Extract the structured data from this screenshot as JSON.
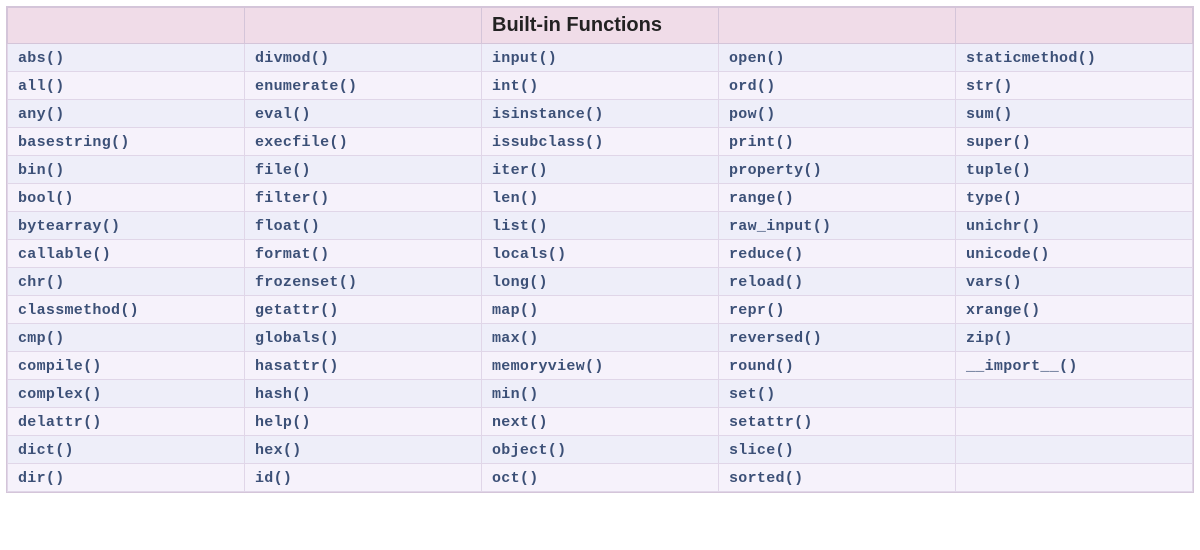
{
  "header": {
    "title": "Built-in Functions"
  },
  "columns": [
    [
      "abs()",
      "all()",
      "any()",
      "basestring()",
      "bin()",
      "bool()",
      "bytearray()",
      "callable()",
      "chr()",
      "classmethod()",
      "cmp()",
      "compile()",
      "complex()",
      "delattr()",
      "dict()",
      "dir()"
    ],
    [
      "divmod()",
      "enumerate()",
      "eval()",
      "execfile()",
      "file()",
      "filter()",
      "float()",
      "format()",
      "frozenset()",
      "getattr()",
      "globals()",
      "hasattr()",
      "hash()",
      "help()",
      "hex()",
      "id()"
    ],
    [
      "input()",
      "int()",
      "isinstance()",
      "issubclass()",
      "iter()",
      "len()",
      "list()",
      "locals()",
      "long()",
      "map()",
      "max()",
      "memoryview()",
      "min()",
      "next()",
      "object()",
      "oct()"
    ],
    [
      "open()",
      "ord()",
      "pow()",
      "print()",
      "property()",
      "range()",
      "raw_input()",
      "reduce()",
      "reload()",
      "repr()",
      "reversed()",
      "round()",
      "set()",
      "setattr()",
      "slice()",
      "sorted()"
    ],
    [
      "staticmethod()",
      "str()",
      "sum()",
      "super()",
      "tuple()",
      "type()",
      "unichr()",
      "unicode()",
      "vars()",
      "xrange()",
      "zip()",
      "__import__()",
      "",
      "",
      "",
      ""
    ]
  ]
}
